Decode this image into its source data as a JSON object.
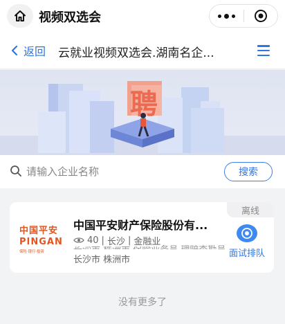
{
  "top_bar": {
    "title": "视频双选会"
  },
  "nav": {
    "back_label": "返回",
    "page_title": "云就业视频双选会.湖南名企..."
  },
  "banner": {
    "art_character": "聘"
  },
  "search": {
    "placeholder": "请输入企业名称",
    "value": "",
    "button_label": "搜索"
  },
  "companies": [
    {
      "status": "离线",
      "logo_cn": "中国平安",
      "logo_en": "PINGAN",
      "logo_sub": "保险·银行·投资",
      "name": "中国平安财产保险股份有...",
      "views": "40",
      "city": "长沙",
      "industry": "金融业",
      "hidden_line": "长沙市 株洲市 保险业务员 理赔查勘员",
      "location": "长沙市 株洲市",
      "action_label": "面试排队"
    }
  ],
  "footer": {
    "no_more": "没有更多了"
  },
  "colors": {
    "accent": "#2f76e0",
    "logo": "#e2551f",
    "background": "#f2f3f5"
  }
}
